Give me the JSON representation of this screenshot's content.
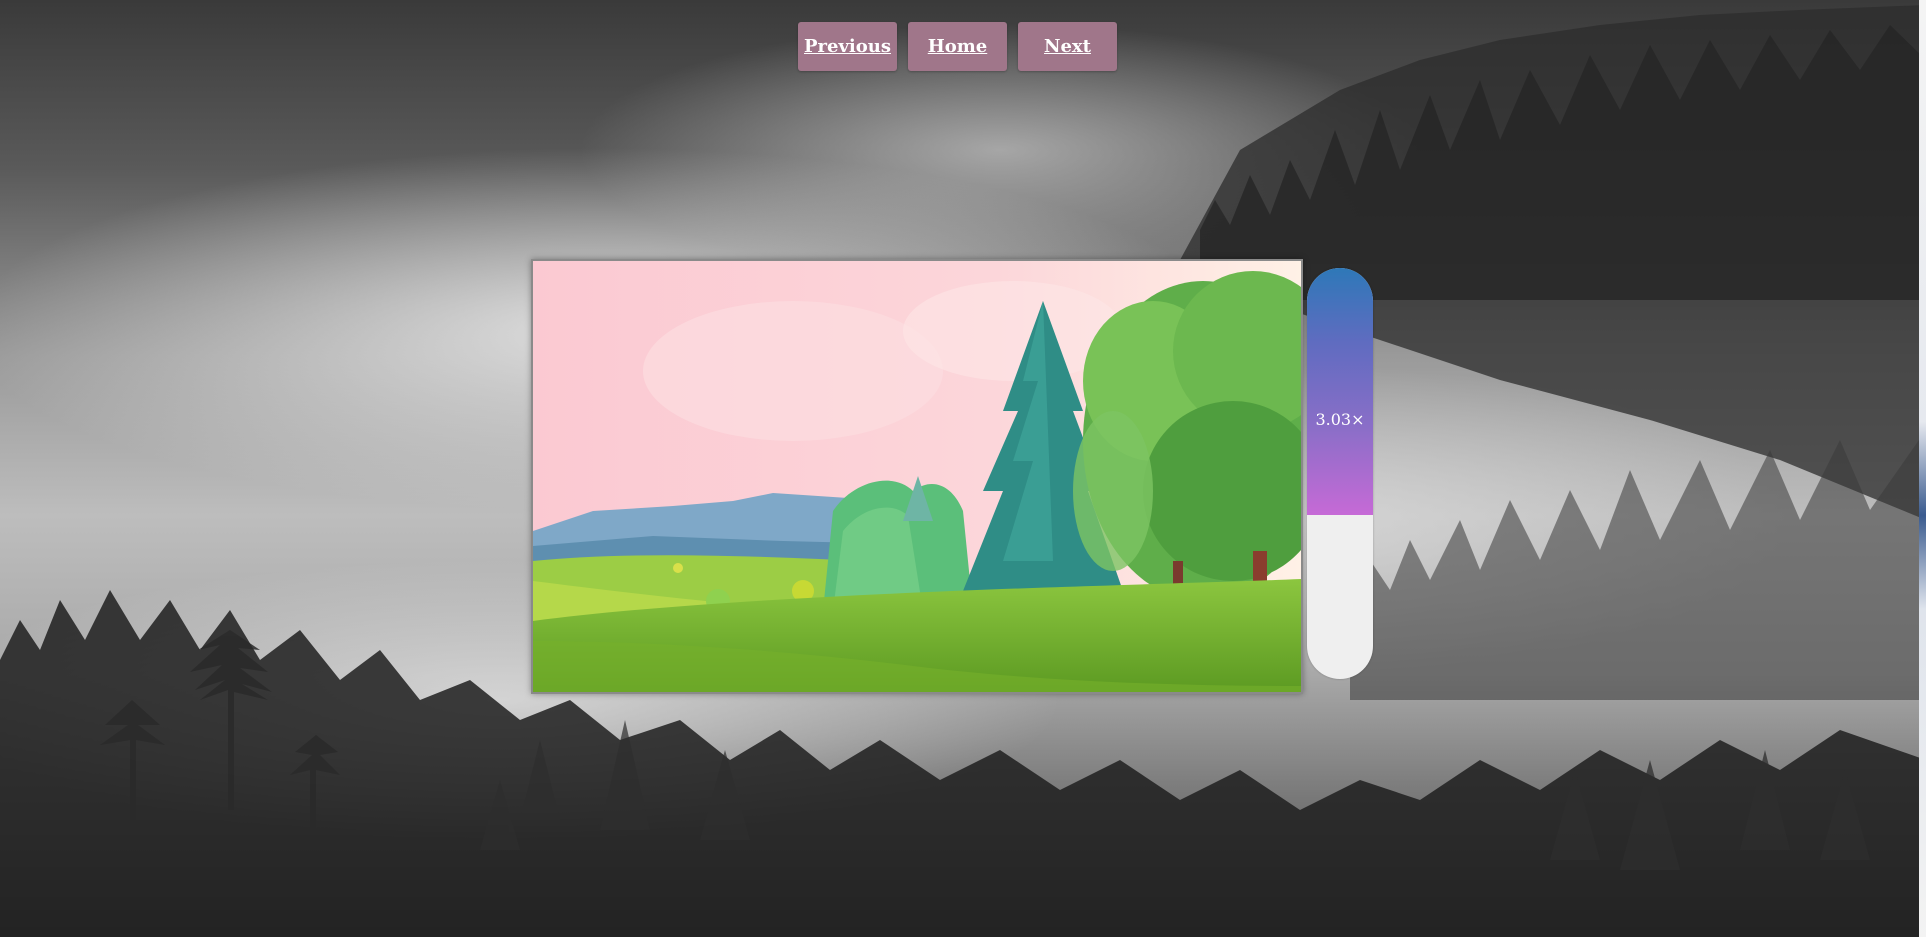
{
  "nav": {
    "previous_label": "Previous",
    "home_label": "Home",
    "next_label": "Next"
  },
  "zoom": {
    "value_label": "3.03×",
    "fill_fraction": 0.6
  },
  "colors": {
    "button_bg": "#a0768a",
    "slider_top": "#2e78b8",
    "slider_bottom": "#c66ad6",
    "slider_track": "#efefef"
  }
}
